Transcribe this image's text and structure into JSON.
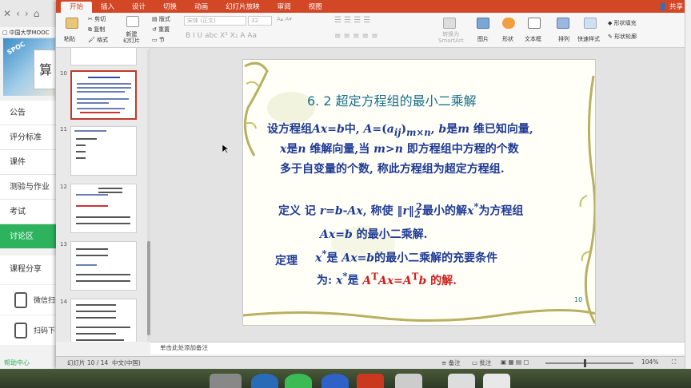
{
  "browser": {
    "tab_title": "中国大学MOOC",
    "menu": [
      "公告",
      "评分标准",
      "课件",
      "测验与作业",
      "考试",
      "讨论区"
    ],
    "active_menu": "讨论区",
    "share": "课程分享",
    "wechat": "微信扫",
    "scan": "扫码下",
    "help": "帮助中心"
  },
  "ribbon": {
    "tabs": [
      "开始",
      "插入",
      "设计",
      "切换",
      "动画",
      "幻灯片放映",
      "审阅",
      "视图"
    ],
    "active_tab": "开始",
    "share": "共享",
    "paste": "粘贴",
    "cut": "剪切",
    "copy": "复制",
    "format": "格式",
    "new_slide": "新建\n幻灯片",
    "layout": "版式",
    "reset": "重置",
    "section": "节",
    "font_name": "宋体 (正文)",
    "font_size": "32",
    "convert_smartart": "转换为\nSmartArt",
    "picture": "图片",
    "shape": "形状",
    "textbox": "文本框",
    "arrange": "排列",
    "quick_styles": "快速样式",
    "shape_fill": "形状填充",
    "shape_outline": "形状轮廓"
  },
  "thumbs": [
    {
      "num": "10",
      "selected": true
    },
    {
      "num": "11",
      "selected": false
    },
    {
      "num": "12",
      "selected": false
    },
    {
      "num": "13",
      "selected": false
    },
    {
      "num": "14",
      "selected": false
    }
  ],
  "slide": {
    "title": "6. 2     超定方程组的最小二乘解",
    "page_number": "10"
  },
  "notes_placeholder": "单击此处添加备注",
  "status": {
    "slide_info": "幻灯片 10 / 14",
    "language": "中文(中国)",
    "notes": "备注",
    "comments": "批注",
    "zoom": "104%"
  }
}
